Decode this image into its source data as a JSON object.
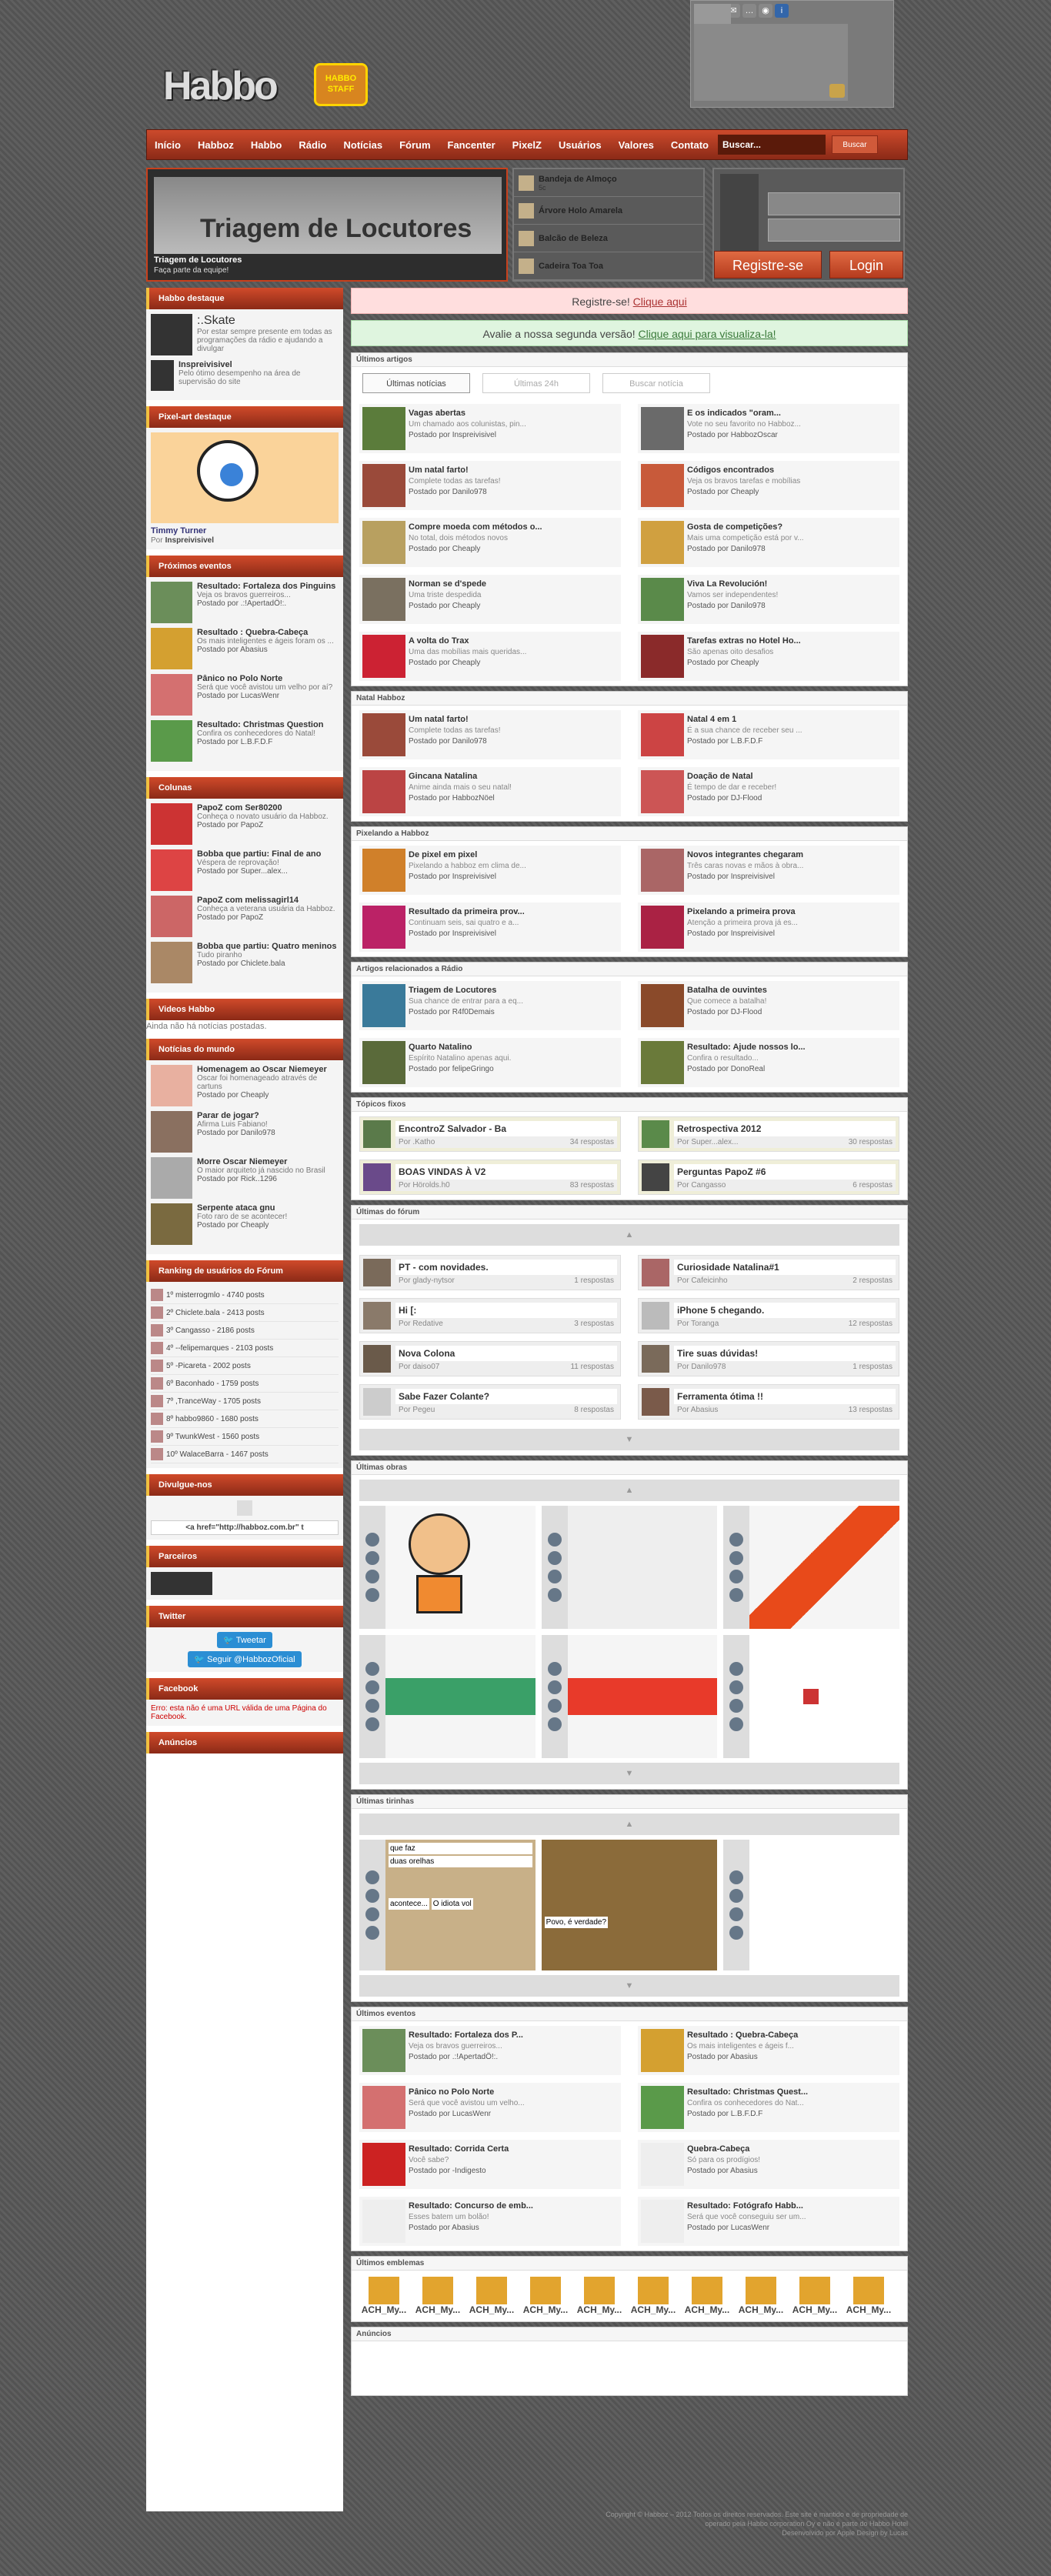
{
  "header": {
    "logo_text": "Habbo",
    "badge_text": "HABBO\nSTAFF"
  },
  "nav": {
    "items": [
      "Início",
      "Habboz",
      "Habbo",
      "Rádio",
      "Notícias",
      "Fórum",
      "Fancenter",
      "PixelZ",
      "Usuários",
      "Valores",
      "Contato"
    ],
    "search_placeholder": "Buscar...",
    "search_button": "Buscar"
  },
  "banner": {
    "title": "Triagem de Locutores",
    "caption": "Triagem de Locutores",
    "subcaption": "Faça parte da equipe!"
  },
  "latest": [
    {
      "title": "Bandeja de Almoço",
      "by": "5c"
    },
    {
      "title": "Árvore Holo Amarela",
      "by": ""
    },
    {
      "title": "Balcão de Beleza",
      "by": ""
    },
    {
      "title": "Cadeira Toa Toa",
      "by": ""
    }
  ],
  "login": {
    "register": "Registre-se",
    "login": "Login"
  },
  "alerts": {
    "register_prefix": "Registre-se!",
    "register_link": "Clique aqui",
    "version_prefix": "Avalie a nossa segunda versão!",
    "version_link": "Clique aqui para visualiza-la!"
  },
  "sidebar": {
    "highlight": {
      "title": "Habbo destaque",
      "name": ":.Skate",
      "desc": "Por estar sempre presente em todas as programações da rádio e ajudando a divulgar",
      "user2": "Inspreivisivel",
      "desc2": "Pelo ótimo desempenho na área de supervisão do site"
    },
    "pixel": {
      "title": "Pixel-art destaque",
      "name": "Timmy Turner",
      "by": "Por",
      "author": "Inspreivisivel"
    },
    "events": {
      "title": "Próximos eventos",
      "items": [
        {
          "a": "Resultado: Fortaleza dos Pinguins",
          "b": "Veja os bravos guerreiros...",
          "c": "Postado por .:!ApertadÖ!:."
        },
        {
          "a": "Resultado : Quebra-Cabeça",
          "b": "Os mais inteligentes e ágeis foram os ...",
          "c": "Postado por Abasius"
        },
        {
          "a": "Pânico no Polo Norte",
          "b": "Será que você avistou um velho por aí?",
          "c": "Postado por LucasWenr"
        },
        {
          "a": "Resultado: Christmas Question",
          "b": "Confira os conhecedores do Natal!",
          "c": "Postado por L.B.F.D.F"
        }
      ]
    },
    "columns": {
      "title": "Colunas",
      "items": [
        {
          "a": "PapoZ com Ser80200",
          "b": "Conheça o novato usuário da Habboz.",
          "c": "Postado por PapoZ"
        },
        {
          "a": "Bobba que partiu: Final de ano",
          "b": "Véspera de reprovação!",
          "c": "Postado por Super...alex..."
        },
        {
          "a": "PapoZ com melissagirl14",
          "b": "Conheça a veterana usuária da Habboz.",
          "c": "Postado por PapoZ"
        },
        {
          "a": "Bobba que partiu: Quatro meninos",
          "b": "Tudo piranho",
          "c": "Postado por Chiclete.bala"
        }
      ]
    },
    "videos": {
      "title": "Videos Habbo",
      "empty": "Ainda não há notícias postadas."
    },
    "world": {
      "title": "Notícias do mundo",
      "items": [
        {
          "a": "Homenagem ao Oscar Niemeyer",
          "b": "Oscar foi homenageado através de cartuns",
          "c": "Postado por Cheaply"
        },
        {
          "a": "Parar de jogar?",
          "b": "Afirma Luis Fabiano!",
          "c": "Postado por Danilo978"
        },
        {
          "a": "Morre Oscar Niemeyer",
          "b": "O maior arquiteto já nascido no Brasil",
          "c": "Postado por Rick..1296"
        },
        {
          "a": "Serpente ataca gnu",
          "b": "Foto raro de se acontecer!",
          "c": "Postado por Cheaply"
        }
      ]
    },
    "ranking": {
      "title": "Ranking de usuários do Fórum",
      "items": [
        "1º misterrogmlo - 4740 posts",
        "2º Chiclete.bala - 2413 posts",
        "3º Cangasso - 2186 posts",
        "4º --felipemarques - 2103 posts",
        "5º -Picareta - 2002 posts",
        "6º Baconhado - 1759 posts",
        "7º ,TranceWay - 1705 posts",
        "8º habbo9860 - 1680 posts",
        "9º TwunkWest - 1560 posts",
        "10º WalaceBarra - 1467 posts"
      ]
    },
    "divulgue": {
      "title": "Divulgue-nos",
      "code": "<a href=\"http://habboz.com.br\" t"
    },
    "partners": {
      "title": "Parceiros"
    },
    "twitter": {
      "title": "Twitter",
      "tweet": "Tweetar",
      "follow": "Seguir @HabbozOficial"
    },
    "facebook": {
      "title": "Facebook",
      "error": "Erro: esta não é uma URL válida de uma Página do Facebook."
    },
    "ads": {
      "title": "Anúncios"
    }
  },
  "latest_articles": {
    "title": "Últimos artigos",
    "tabs": [
      "Últimas notícias",
      "Últimas 24h",
      "Buscar notícia"
    ],
    "items": [
      {
        "a": "Vagas abertas",
        "b": "Um chamado aos colunistas, pin...",
        "c": "Postado por Inspreivisivel"
      },
      {
        "a": "E os indicados \"oram...",
        "b": "Vote no seu favorito no Habboz...",
        "c": "Postado por HabbozOscar"
      },
      {
        "a": "Um natal farto!",
        "b": "Complete todas as tarefas!",
        "c": "Postado por Danilo978"
      },
      {
        "a": "Códigos encontrados",
        "b": "Veja os bravos tarefas e mobílias",
        "c": "Postado por Cheaply"
      },
      {
        "a": "Compre moeda com métodos o...",
        "b": "No total, dois métodos novos",
        "c": "Postado por Cheaply"
      },
      {
        "a": "Gosta de competições?",
        "b": "Mais uma competição está por v...",
        "c": "Postado por Danilo978"
      },
      {
        "a": "Norman se d'spede",
        "b": "Uma triste despedida",
        "c": "Postado por Cheaply"
      },
      {
        "a": "Viva La Revolución!",
        "b": "Vamos ser independentes!",
        "c": "Postado por Danilo978"
      },
      {
        "a": "A volta do Trax",
        "b": "Uma das mobílias mais queridas...",
        "c": "Postado por Cheaply"
      },
      {
        "a": "Tarefas extras no Hotel Ho...",
        "b": "São apenas oito desafios",
        "c": "Postado por Cheaply"
      }
    ]
  },
  "natal": {
    "title": "Natal Habboz",
    "items": [
      {
        "a": "Um natal farto!",
        "b": "Complete todas as tarefas!",
        "c": "Postado por Danilo978"
      },
      {
        "a": "Natal 4 em 1",
        "b": "É a sua chance de receber seu ...",
        "c": "Postado por L.B.F.D.F"
      },
      {
        "a": "Gincana Natalina",
        "b": "Anime ainda mais o seu natal!",
        "c": "Postado por HabbozNöel"
      },
      {
        "a": "Doação de Natal",
        "b": "É tempo de dar e receber!",
        "c": "Postado por DJ-Flood"
      }
    ]
  },
  "pixel_section": {
    "title": "Pixelando a Habboz",
    "items": [
      {
        "a": "De pixel em pixel",
        "b": "Pixelando a habboz em clima de...",
        "c": "Postado por Inspreivisivel"
      },
      {
        "a": "Novos integrantes chegaram",
        "b": "Três caras novas e mãos à obra...",
        "c": "Postado por Inspreivisivel"
      },
      {
        "a": "Resultado da primeira prov...",
        "b": "Continuam seis, sai quatro e a...",
        "c": "Postado por Inspreivisivel"
      },
      {
        "a": "Pixelando a primeira prova",
        "b": "Atenção a primeira prova já es...",
        "c": "Postado por Inspreivisivel"
      }
    ]
  },
  "radio_section": {
    "title": "Artigos relacionados a Rádio",
    "items": [
      {
        "a": "Triagem de Locutores",
        "b": "Sua chance de entrar para a eq...",
        "c": "Postado por R4f0Demais"
      },
      {
        "a": "Batalha de ouvintes",
        "b": "Que comece a batalha!",
        "c": "Postado por DJ-Flood"
      },
      {
        "a": "Quarto Natalino",
        "b": "Espírito Natalino apenas aqui.",
        "c": "Postado por felipeGringo"
      },
      {
        "a": "Resultado: Ajude nossos lo...",
        "b": "Confira o resultado...",
        "c": "Postado por DonoReal"
      }
    ]
  },
  "fixed_topics": {
    "title": "Tópicos fixos",
    "items": [
      {
        "t": "EncontroZ Salvador - Ba",
        "by": "Por .Katho",
        "r": "34 respostas"
      },
      {
        "t": "Retrospectiva 2012",
        "by": "Por Super...alex...",
        "r": "30 respostas"
      },
      {
        "t": "BOAS VINDAS À V2",
        "by": "Por Hörolds.h0",
        "r": "83 respostas"
      },
      {
        "t": "Perguntas PapoZ #6",
        "by": "Por Cangasso",
        "r": "6 respostas"
      }
    ]
  },
  "forum": {
    "title": "Últimas do fórum",
    "items": [
      {
        "t": "PT - com novidades.",
        "by": "Por glady-nytsor",
        "r": "1 respostas"
      },
      {
        "t": "Curiosidade Natalina#1",
        "by": "Por Cafeicinho",
        "r": "2 respostas"
      },
      {
        "t": "Hi [:",
        "by": "Por Redative",
        "r": "3 respostas"
      },
      {
        "t": "iPhone 5 chegando.",
        "by": "Por Toranga",
        "r": "12 respostas"
      },
      {
        "t": "Nova Colona",
        "by": "Por daiso07",
        "r": "11 respostas"
      },
      {
        "t": "Tire suas dúvidas!",
        "by": "Por Danilo978",
        "r": "1 respostas"
      },
      {
        "t": "Sabe Fazer Colante?",
        "by": "Por Pegeu",
        "r": "8 respostas"
      },
      {
        "t": "Ferramenta ótima !!",
        "by": "Por Abasius",
        "r": "13 respostas"
      }
    ]
  },
  "works": {
    "title": "Últimas obras"
  },
  "comics": {
    "title": "Últimas tirinhas",
    "bubbles": [
      "que faz",
      "duas orelhas",
      "Povo, é verdade?",
      "acontece...",
      "O idiota vol"
    ]
  },
  "last_events": {
    "title": "Últimos eventos",
    "items": [
      {
        "a": "Resultado: Fortaleza dos P...",
        "b": "Veja os bravos guerreiros...",
        "c": "Postado por .:!ApertadÖ!:."
      },
      {
        "a": "Resultado : Quebra-Cabeça",
        "b": "Os mais inteligentes e ágeis f...",
        "c": "Postado por Abasius"
      },
      {
        "a": "Pânico no Polo Norte",
        "b": "Será que você avistou um velho...",
        "c": "Postado por LucasWenr"
      },
      {
        "a": "Resultado: Christmas Quest...",
        "b": "Confira os conhecedores do Nat...",
        "c": "Postado por L.B.F.D.F"
      },
      {
        "a": "Resultado: Corrida Certa",
        "b": "Você sabe?",
        "c": "Postado por -Indigesto"
      },
      {
        "a": "Quebra-Cabeça",
        "b": "Só para os prodígios!",
        "c": "Postado por Abasius"
      },
      {
        "a": "Resultado: Concurso de emb...",
        "b": "Esses batem um bolão!",
        "c": "Postado por Abasius"
      },
      {
        "a": "Resultado: Fotógrafo Habb...",
        "b": "Será que você conseguiu ser um...",
        "c": "Postado por LucasWenr"
      }
    ]
  },
  "badges": {
    "title": "Últimos emblemas",
    "items": [
      "ACH_My...",
      "ACH_My...",
      "ACH_My...",
      "ACH_My...",
      "ACH_My...",
      "ACH_My...",
      "ACH_My...",
      "ACH_My...",
      "ACH_My...",
      "ACH_My..."
    ]
  },
  "ads_main": {
    "title": "Anúncios"
  },
  "footer": {
    "line1": "Copyright © Habboz – 2012 Todos os direitos reservados. Este site é mantido e de propriedade de",
    "line2": "operado pela Habbo corporation Oy e não é parte do Habbo Hotel",
    "line3": "Desenvolvido por Apple Design by Lucas"
  }
}
